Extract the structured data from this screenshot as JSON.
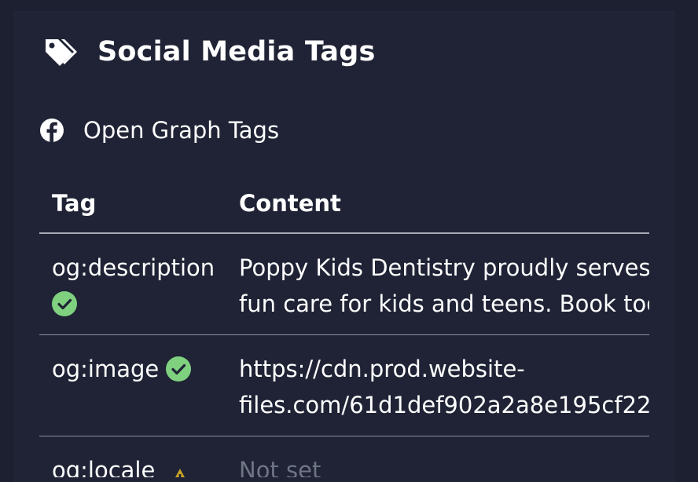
{
  "section": {
    "title": "Social Media Tags",
    "icon": "tags-icon"
  },
  "open_graph": {
    "title": "Open Graph Tags",
    "icon": "facebook-icon"
  },
  "table": {
    "headers": [
      "Tag",
      "Content"
    ],
    "rows": [
      {
        "tag": "og:description",
        "status": "ok",
        "content_lines": [
          "Poppy Kids Dentistry proudly serves",
          "fun care for kids and teens. Book tod"
        ]
      },
      {
        "tag": "og:image",
        "status": "ok",
        "content_lines": [
          "https://cdn.prod.website-",
          "files.com/61d1def902a2a8e195cf22"
        ]
      },
      {
        "tag": "og:locale",
        "status": "warning",
        "content_lines": [
          "Not set"
        ]
      }
    ]
  },
  "colors": {
    "background": "#1c2030",
    "panel": "#1f2335",
    "success": "#7fd17f",
    "warning": "#c9a227",
    "muted_text": "#6f7585"
  }
}
